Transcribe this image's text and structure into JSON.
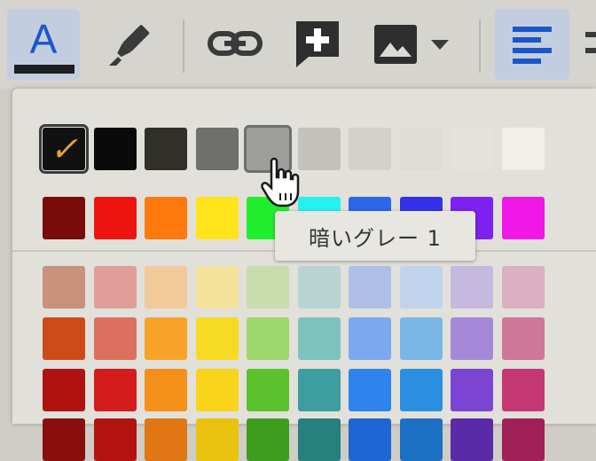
{
  "toolbar": {
    "text_color_letter": "A",
    "text_color_underline": "#1f1f1f",
    "accent": "#1a57c9",
    "items": [
      {
        "name": "text-color-button",
        "icon": "text-color-icon",
        "active": true
      },
      {
        "name": "highlight-button",
        "icon": "highlighter-icon"
      },
      {
        "name": "link-button",
        "icon": "link-icon"
      },
      {
        "name": "add-comment-button",
        "icon": "add-comment-icon"
      },
      {
        "name": "insert-image-button",
        "icon": "image-icon"
      },
      {
        "name": "align-button",
        "icon": "align-left-icon",
        "active": true
      }
    ]
  },
  "palette": {
    "gray_row": [
      "#111111",
      "#0a0a0a",
      "#303028",
      "#6f6f6b",
      "#9e9e9a",
      "#c2c1bc",
      "#d2d1cb",
      "#dddcd6",
      "#e3e2dc",
      "#f0efea"
    ],
    "bright_row": [
      "#7a0b0b",
      "#ee1510",
      "#ff7a0e",
      "#ffe41c",
      "#21ee2c",
      "#25f2f0",
      "#2b67e8",
      "#3232e8",
      "#7d22f0",
      "#ef18e6"
    ],
    "shade_rows": [
      [
        "#c9917c",
        "#df9f98",
        "#f2c998",
        "#f4e29a",
        "#c9dcae",
        "#b8d4d2",
        "#aebfe8",
        "#bfd4ec",
        "#c5b9df",
        "#dbb0c0"
      ],
      [
        "#cd4a19",
        "#dd6f60",
        "#f7a32a",
        "#f7da24",
        "#9ed86c",
        "#7ec2c0",
        "#7ba9f0",
        "#7ab7e6",
        "#a589d8",
        "#d07699"
      ],
      [
        "#b0130f",
        "#d51c1c",
        "#f5901a",
        "#f8d41a",
        "#5bc22e",
        "#3d9ea0",
        "#2f83ee",
        "#2a8fe0",
        "#7b44d2",
        "#c43874"
      ],
      [
        "#8a0f0c",
        "#b3130f",
        "#e07712",
        "#e9c210",
        "#3e9d1e",
        "#25807e",
        "#1e66d4",
        "#1c70c4",
        "#5b2aa8",
        "#a22058"
      ]
    ],
    "selected_index": 0,
    "hovered_index": 4,
    "check_mark": "✓"
  },
  "tooltip": {
    "text": "暗いグレー 1"
  }
}
